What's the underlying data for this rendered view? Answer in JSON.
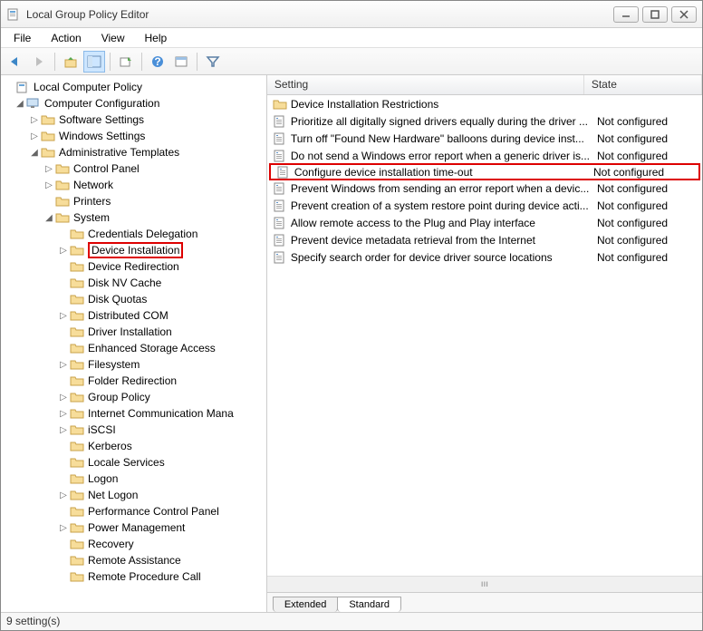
{
  "window": {
    "title": "Local Group Policy Editor"
  },
  "menus": [
    "File",
    "Action",
    "View",
    "Help"
  ],
  "tree": {
    "root": "Local Computer Policy",
    "comp_config": "Computer Configuration",
    "software": "Software Settings",
    "windows": "Windows Settings",
    "admin": "Administrative Templates",
    "cp": "Control Panel",
    "net": "Network",
    "prn": "Printers",
    "sys": "System",
    "sys_items": [
      "Credentials Delegation",
      "Device Installation",
      "Device Redirection",
      "Disk NV Cache",
      "Disk Quotas",
      "Distributed COM",
      "Driver Installation",
      "Enhanced Storage Access",
      "Filesystem",
      "Folder Redirection",
      "Group Policy",
      "Internet Communication Mana",
      "iSCSI",
      "Kerberos",
      "Locale Services",
      "Logon",
      "Net Logon",
      "Performance Control Panel",
      "Power Management",
      "Recovery",
      "Remote Assistance",
      "Remote Procedure Call"
    ]
  },
  "columns": {
    "setting": "Setting",
    "state": "State"
  },
  "list": [
    {
      "t": "Device Installation Restrictions",
      "s": "",
      "folder": true
    },
    {
      "t": "Prioritize all digitally signed drivers equally during the driver ...",
      "s": "Not configured"
    },
    {
      "t": "Turn off \"Found New Hardware\" balloons during device inst...",
      "s": "Not configured"
    },
    {
      "t": "Do not send a Windows error report when a generic driver is...",
      "s": "Not configured"
    },
    {
      "t": "Configure device installation time-out",
      "s": "Not configured",
      "hl": true
    },
    {
      "t": "Prevent Windows from sending an error report when a devic...",
      "s": "Not configured"
    },
    {
      "t": "Prevent creation of a system restore point during device acti...",
      "s": "Not configured"
    },
    {
      "t": "Allow remote access to the Plug and Play interface",
      "s": "Not configured"
    },
    {
      "t": "Prevent device metadata retrieval from the Internet",
      "s": "Not configured"
    },
    {
      "t": "Specify search order for device driver source locations",
      "s": "Not configured"
    }
  ],
  "tabs": {
    "ext": "Extended",
    "std": "Standard"
  },
  "status": "9 setting(s)"
}
